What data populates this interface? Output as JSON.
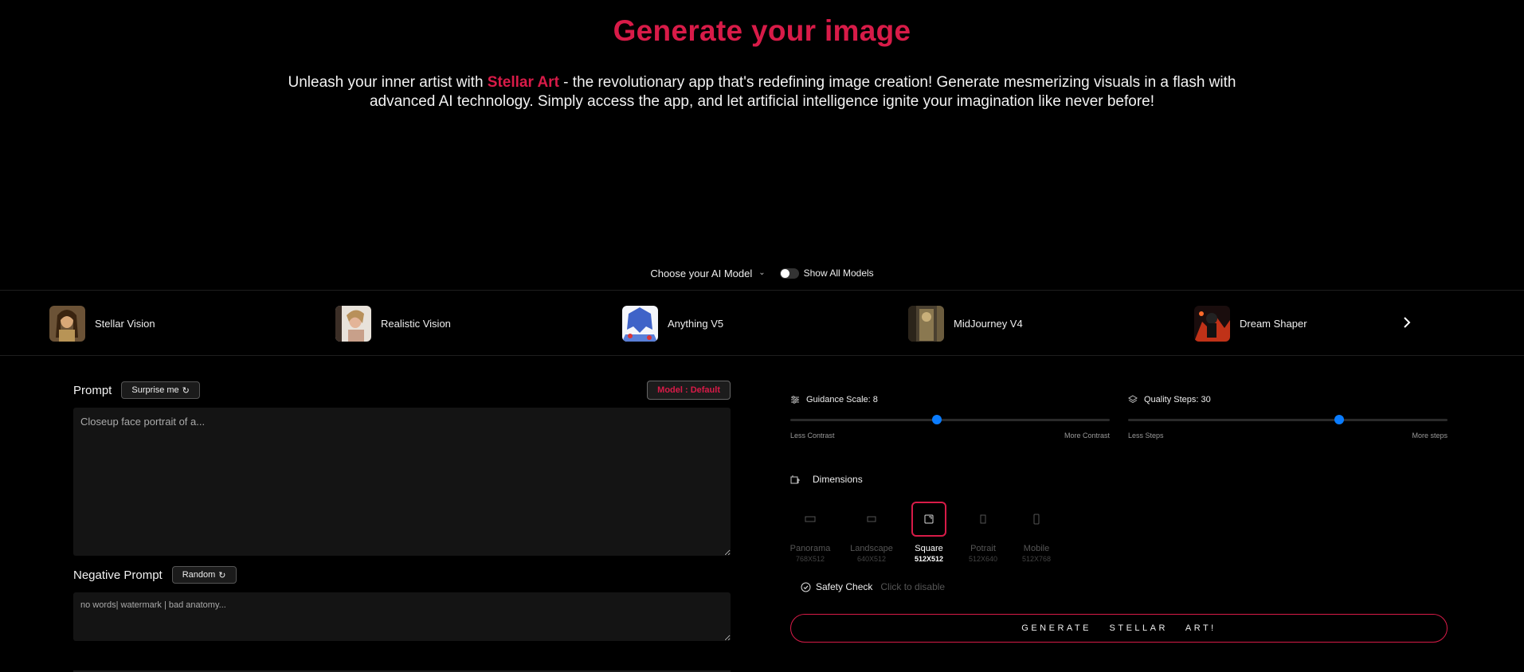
{
  "header": {
    "title": "Generate your image",
    "intro_before": "Unleash your inner artist with ",
    "brand": "Stellar Art",
    "intro_after": " - the revolutionary app that's redefining image creation! Generate mesmerizing visuals in a flash with advanced AI technology. Simply access the app, and let artificial intelligence ignite your imagination like never before!"
  },
  "model_selector": {
    "choose_label": "Choose your AI Model",
    "show_all_label": "Show All Models",
    "show_all_enabled": false
  },
  "models": [
    {
      "name": "Stellar Vision"
    },
    {
      "name": "Realistic Vision"
    },
    {
      "name": "Anything V5"
    },
    {
      "name": "MidJourney V4"
    },
    {
      "name": "Dream Shaper"
    }
  ],
  "prompt": {
    "label": "Prompt",
    "surprise_label": "Surprise me",
    "model_badge": "Model : Default",
    "placeholder": "Closeup face portrait of a...",
    "value": ""
  },
  "negative_prompt": {
    "label": "Negative Prompt",
    "random_label": "Random",
    "placeholder": "no words| watermark | bad anatomy...",
    "value": ""
  },
  "guidance": {
    "label": "Guidance Scale: 8",
    "value": 8,
    "min_label": "Less Contrast",
    "max_label": "More Contrast",
    "fraction": 0.46
  },
  "quality": {
    "label": "Quality Steps: 30",
    "value": 30,
    "min_label": "Less Steps",
    "max_label": "More steps",
    "fraction": 0.66
  },
  "dimensions": {
    "label": "Dimensions",
    "selected": "Square",
    "options": [
      {
        "name": "Panorama",
        "size": "768X512"
      },
      {
        "name": "Landscape",
        "size": "640X512"
      },
      {
        "name": "Square",
        "size": "512X512"
      },
      {
        "name": "Potrait",
        "size": "512X640"
      },
      {
        "name": "Mobile",
        "size": "512X768"
      }
    ]
  },
  "safety": {
    "label": "Safety Check",
    "hint": "Click to disable"
  },
  "generate_label": "GENERATE STELLAR ART!",
  "colors": {
    "accent": "#d81b48",
    "slider": "#0a7cff",
    "background": "#000000"
  }
}
